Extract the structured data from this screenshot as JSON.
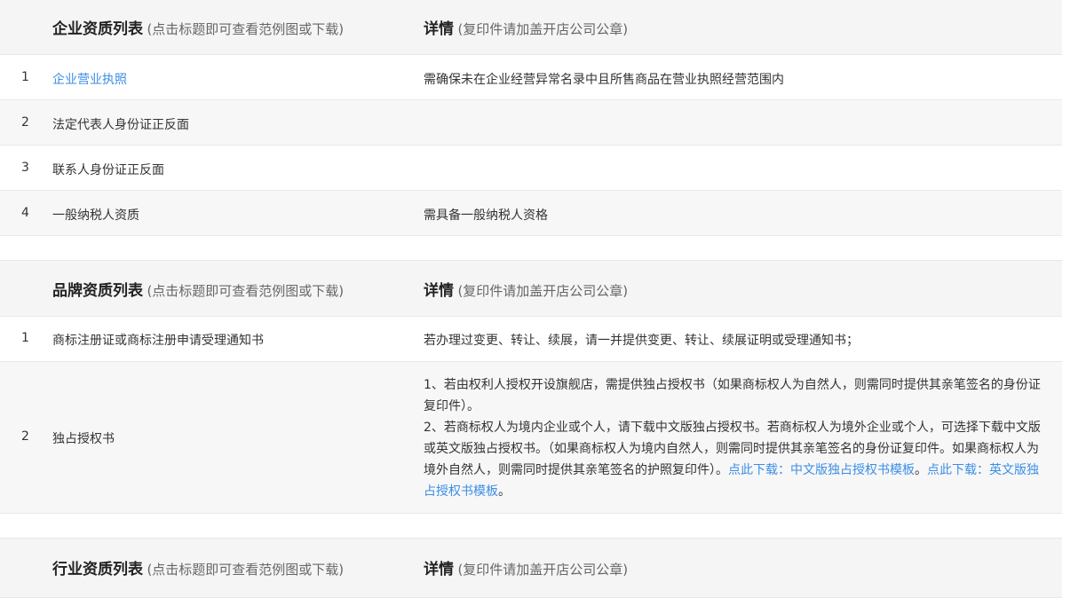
{
  "company": {
    "header": {
      "list_title": "企业资质列表",
      "list_hint": "(点击标题即可查看范例图或下载)",
      "detail_title": "详情",
      "detail_hint": "(复印件请加盖开店公司公章)"
    },
    "rows": [
      {
        "index": "1",
        "name": "企业营业执照",
        "detail": "需确保未在企业经营异常名录中且所售商品在营业执照经营范围内"
      },
      {
        "index": "2",
        "name": "法定代表人身份证正反面",
        "detail": ""
      },
      {
        "index": "3",
        "name": "联系人身份证正反面",
        "detail": ""
      },
      {
        "index": "4",
        "name": "一般纳税人资质",
        "detail": "需具备一般纳税人资格"
      }
    ]
  },
  "brand": {
    "header": {
      "list_title": "品牌资质列表",
      "list_hint": "(点击标题即可查看范例图或下载)",
      "detail_title": "详情",
      "detail_hint": "(复印件请加盖开店公司公章)"
    },
    "rows": [
      {
        "index": "1",
        "name": "商标注册证或商标注册申请受理通知书",
        "detail": "若办理过变更、转让、续展，请一并提供变更、转让、续展证明或受理通知书；"
      },
      {
        "index": "2",
        "name": "独占授权书",
        "detail_lines": [
          "1、若由权利人授权开设旗舰店，需提供独占授权书（如果商标权人为自然人，则需同时提供其亲笔签名的身份证复印件）。",
          "2、若商标权人为境内企业或个人，请下载中文版独占授权书。若商标权人为境外企业或个人，可选择下载中文版或英文版独占授权书。（如果商标权人为境内自然人，则需同时提供其亲笔签名的身份证复印件。如果商标权人为境外自然人，则需同时提供其亲笔签名的护照复印件）。"
        ],
        "link_cn": "点此下载：中文版独占授权书模板",
        "link_sep": "。",
        "link_en": "点此下载：英文版独占授权书模板",
        "link_end": "。"
      }
    ]
  },
  "industry": {
    "header": {
      "list_title": "行业资质列表",
      "list_hint": "(点击标题即可查看范例图或下载)",
      "detail_title": "详情",
      "detail_hint": "(复印件请加盖开店公司公章)"
    }
  },
  "colors": {
    "link": "#3a8ee6",
    "header_bg": "#f5f5f5",
    "row_alt_bg": "#f7f7f7",
    "text": "#333333"
  }
}
